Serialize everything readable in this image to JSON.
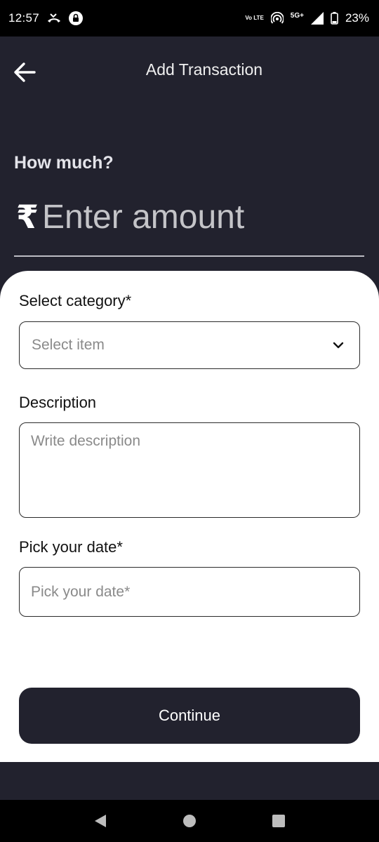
{
  "status_bar": {
    "time": "12:57",
    "volte": "Vo LTE",
    "network": "5G+",
    "battery": "23%"
  },
  "header": {
    "title": "Add Transaction",
    "back_icon": "arrow-left-icon"
  },
  "amount": {
    "label": "How much?",
    "currency_symbol": "₹",
    "placeholder": "Enter amount",
    "value": ""
  },
  "form": {
    "category_label": "Select category*",
    "category_placeholder": "Select item",
    "description_label": "Description",
    "description_placeholder": "Write description",
    "date_label": "Pick your date*",
    "date_placeholder": "Pick your date*",
    "continue_label": "Continue"
  },
  "colors": {
    "primary_dark": "#22222e",
    "card": "#ffffff",
    "placeholder": "#8a8a8a"
  },
  "nav": {
    "back": "triangle-back-icon",
    "home": "circle-home-icon",
    "recents": "square-recents-icon"
  }
}
